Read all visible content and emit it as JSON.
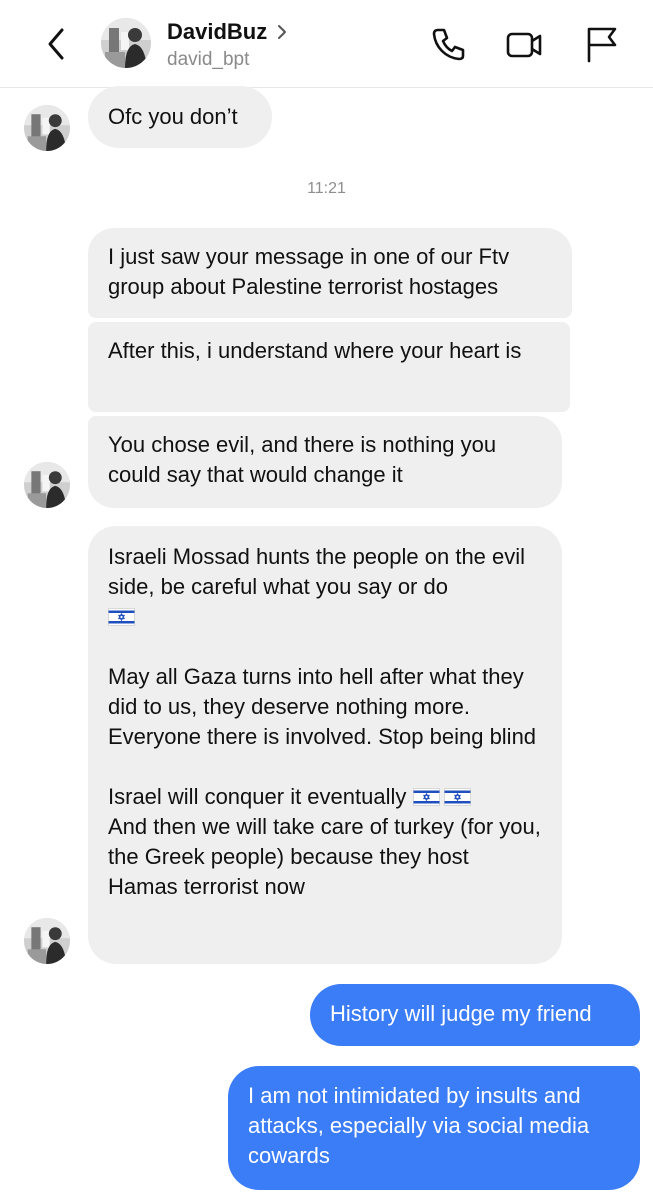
{
  "header": {
    "name": "DavidBuz",
    "username": "david_bpt",
    "icons": {
      "back": "chevron-left-icon",
      "profile": "chevron-right-icon",
      "call": "phone-icon",
      "video": "video-camera-icon",
      "report": "flag-icon"
    }
  },
  "timestamp": "11:21",
  "messages": {
    "m0": "Ofc you don’t",
    "m1": "I just saw your message in one of our Ftv group about Palestine terrorist hostages",
    "m2": "After this, i understand where your heart is",
    "m3": "You chose evil, and there is nothing you could say that would change it",
    "m4": {
      "p1": "Israeli Mossad hunts the people on the evil side, be careful what you say or do",
      "p2": "May all Gaza turns into hell after what they did to us, they deserve nothing more. Everyone there is involved. Stop being blind",
      "p3a": "Israel will conquer it eventually",
      "p3b": "And then we will take care of turkey (for you, the Greek people) because they host Hamas terrorist now"
    },
    "m5": "History will judge my friend",
    "m6": "I am not intimidated by insults and attacks, especially via social media cowards"
  },
  "colors": {
    "incoming_bubble": "#efefef",
    "outgoing_bubble": "#3b7cf7",
    "meta_text": "#8e8e8e"
  }
}
